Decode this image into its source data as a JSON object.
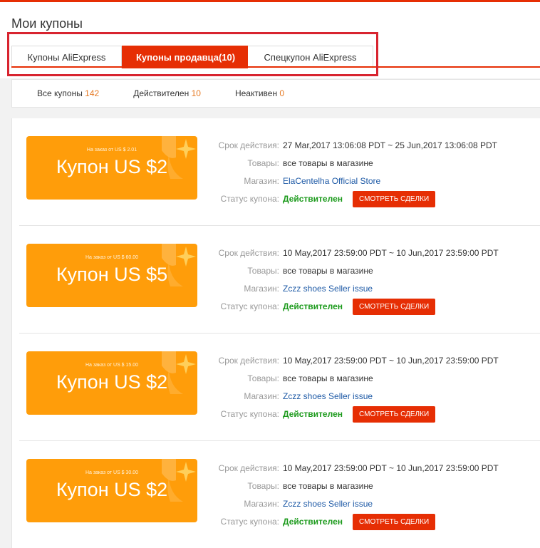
{
  "page": {
    "title": "Мои купоны",
    "accent_color": "#e62e04",
    "highlight_color": "#d8242f"
  },
  "tabs": [
    {
      "label": "Купоны AliExpress",
      "active": false
    },
    {
      "label": "Купоны продавца(10)",
      "active": true
    },
    {
      "label": "Спецкупон AliExpress",
      "active": false
    }
  ],
  "filters": [
    {
      "label": "Все купоны",
      "count": "142"
    },
    {
      "label": "Действителен",
      "count": "10"
    },
    {
      "label": "Неактивен",
      "count": "0"
    }
  ],
  "labels": {
    "validity": "Срок действия:",
    "goods": "Товары:",
    "store": "Магазин:",
    "status": "Статус купона:",
    "deal_button": "СМОТРЕТЬ СДЕЛКИ"
  },
  "coupons": [
    {
      "min_order": "На заказ от US $ 2.01",
      "amount": "Купон US $2",
      "validity": "27 Mar,2017 13:06:08 PDT ~ 25 Jun,2017 13:06:08 PDT",
      "goods": "все товары в магазине",
      "store": "ElaCentelha Official Store",
      "status": "Действителен"
    },
    {
      "min_order": "На заказ от US $ 60.00",
      "amount": "Купон US $5",
      "validity": "10 May,2017 23:59:00 PDT ~ 10 Jun,2017 23:59:00 PDT",
      "goods": "все товары в магазине",
      "store": "Zczz shoes Seller issue",
      "status": "Действителен"
    },
    {
      "min_order": "На заказ от US $ 15.00",
      "amount": "Купон US $2",
      "validity": "10 May,2017 23:59:00 PDT ~ 10 Jun,2017 23:59:00 PDT",
      "goods": "все товары в магазине",
      "store": "Zczz shoes Seller issue",
      "status": "Действителен"
    },
    {
      "min_order": "На заказ от US $ 30.00",
      "amount": "Купон US $2",
      "validity": "10 May,2017 23:59:00 PDT ~ 10 Jun,2017 23:59:00 PDT",
      "goods": "все товары в магазине",
      "store": "Zczz shoes Seller issue",
      "status": "Действителен"
    }
  ]
}
